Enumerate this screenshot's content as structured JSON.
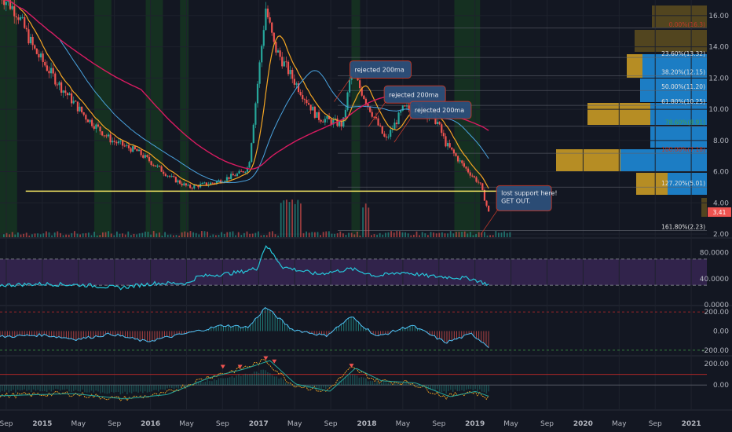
{
  "chart_data": {
    "type": "candlestick",
    "x_axis": {
      "ticks": [
        "Sep",
        "2015",
        "May",
        "Sep",
        "2016",
        "May",
        "Sep",
        "2017",
        "May",
        "Sep",
        "2018",
        "May",
        "Sep",
        "2019",
        "May",
        "Sep",
        "2020",
        "May",
        "Sep",
        "2021"
      ],
      "range": [
        "2014-08",
        "2021-06"
      ]
    },
    "y_axis": {
      "ticks": [
        "16.00",
        "14.00",
        "12.00",
        "10.00",
        "8.00",
        "6.00",
        "4.00",
        "2.00"
      ],
      "range": [
        1.8,
        16.9
      ]
    },
    "price_series": [
      {
        "date": "2014-08",
        "value": 17.4
      },
      {
        "date": "2014-10",
        "value": 16.2
      },
      {
        "date": "2014-12",
        "value": 13.8
      },
      {
        "date": "2015-03",
        "value": 11.5
      },
      {
        "date": "2015-06",
        "value": 9.5
      },
      {
        "date": "2015-09",
        "value": 8.0
      },
      {
        "date": "2015-12",
        "value": 7.3
      },
      {
        "date": "2016-04",
        "value": 5.6
      },
      {
        "date": "2016-06",
        "value": 5.0
      },
      {
        "date": "2016-09",
        "value": 5.3
      },
      {
        "date": "2016-12",
        "value": 5.9
      },
      {
        "date": "2017-01",
        "value": 6.3
      },
      {
        "date": "2017-03",
        "value": 16.5
      },
      {
        "date": "2017-04",
        "value": 14.0
      },
      {
        "date": "2017-06",
        "value": 12.1
      },
      {
        "date": "2017-09",
        "value": 9.5
      },
      {
        "date": "2017-12",
        "value": 9.0
      },
      {
        "date": "2018-01",
        "value": 12.5
      },
      {
        "date": "2018-03",
        "value": 10.2
      },
      {
        "date": "2018-05",
        "value": 8.0
      },
      {
        "date": "2018-07",
        "value": 10.0
      },
      {
        "date": "2018-09",
        "value": 10.1
      },
      {
        "date": "2018-11",
        "value": 9.2
      },
      {
        "date": "2018-12",
        "value": 7.8
      },
      {
        "date": "2019-02",
        "value": 6.4
      },
      {
        "date": "2019-04",
        "value": 5.2
      },
      {
        "date": "2019-05",
        "value": 3.4
      }
    ],
    "support_level": 4.75,
    "fibonacci_levels": [
      {
        "label": "0.00%(16.3)",
        "value": 15.2
      },
      {
        "label": "23.60%(13.32)",
        "value": 13.32
      },
      {
        "label": "38.20%(12.15)",
        "value": 12.15
      },
      {
        "label": "50.00%(11.20)",
        "value": 11.2
      },
      {
        "label": "61.80%(10.25)",
        "value": 10.25
      },
      {
        "label": "78.60%(8.91)",
        "value": 8.91
      },
      {
        "label": "100.00%(7.18)",
        "value": 7.18
      },
      {
        "label": "127.20%(5.01)",
        "value": 5.01
      },
      {
        "label": "161.80%(2.23)",
        "value": 2.23
      }
    ],
    "current_price_label": "3.41",
    "annotations": [
      {
        "text": "rejected 200ma",
        "date": "2018-01",
        "value": 13.0
      },
      {
        "text": "rejected 200ma",
        "date": "2018-05",
        "value": 11.4
      },
      {
        "text": "rejected 200ma",
        "date": "2018-08",
        "value": 10.4
      },
      {
        "text": "lost support here! GET OUT.",
        "date": "2019-05",
        "value": 5.0
      }
    ],
    "rsi_panel": {
      "ticks": [
        "80.0000",
        "40.0000",
        "0.0000"
      ],
      "range": [
        0,
        100
      ],
      "upper_band": 70,
      "lower_band": 30,
      "values": [
        {
          "date": "2014-08",
          "value": 30
        },
        {
          "date": "2015-01",
          "value": 32
        },
        {
          "date": "2015-06",
          "value": 30
        },
        {
          "date": "2015-10",
          "value": 26
        },
        {
          "date": "2016-02",
          "value": 33
        },
        {
          "date": "2016-06",
          "value": 33
        },
        {
          "date": "2016-07",
          "value": 43
        },
        {
          "date": "2016-10",
          "value": 47
        },
        {
          "date": "2016-12",
          "value": 50
        },
        {
          "date": "2017-02",
          "value": 56
        },
        {
          "date": "2017-03",
          "value": 92
        },
        {
          "date": "2017-05",
          "value": 58
        },
        {
          "date": "2017-09",
          "value": 47
        },
        {
          "date": "2018-01",
          "value": 55
        },
        {
          "date": "2018-04",
          "value": 44
        },
        {
          "date": "2018-07",
          "value": 50
        },
        {
          "date": "2018-10",
          "value": 44
        },
        {
          "date": "2019-01",
          "value": 42
        },
        {
          "date": "2019-03",
          "value": 40
        },
        {
          "date": "2019-05",
          "value": 31
        }
      ]
    },
    "cci_panel": {
      "ticks": [
        "200.00",
        "0.00",
        "-200.00"
      ],
      "range": [
        -250,
        250
      ],
      "values": [
        {
          "date": "2014-08",
          "value": -60
        },
        {
          "date": "2015-01",
          "value": -40
        },
        {
          "date": "2015-05",
          "value": -85
        },
        {
          "date": "2015-09",
          "value": -30
        },
        {
          "date": "2016-01",
          "value": -110
        },
        {
          "date": "2016-06",
          "value": -20
        },
        {
          "date": "2016-10",
          "value": 60
        },
        {
          "date": "2017-01",
          "value": 40
        },
        {
          "date": "2017-03",
          "value": 250
        },
        {
          "date": "2017-06",
          "value": 20
        },
        {
          "date": "2017-10",
          "value": -50
        },
        {
          "date": "2018-01",
          "value": 150
        },
        {
          "date": "2018-04",
          "value": -60
        },
        {
          "date": "2018-08",
          "value": 60
        },
        {
          "date": "2018-12",
          "value": -120
        },
        {
          "date": "2019-03",
          "value": -30
        },
        {
          "date": "2019-05",
          "value": -160
        }
      ]
    },
    "oscillator_panel": {
      "ticks": [
        "200.00",
        "0.00"
      ],
      "range": [
        -220,
        260
      ],
      "values": [
        {
          "date": "2014-08",
          "value": -100
        },
        {
          "date": "2015-04",
          "value": -80
        },
        {
          "date": "2015-10",
          "value": -130
        },
        {
          "date": "2016-03",
          "value": -90
        },
        {
          "date": "2016-08",
          "value": 70
        },
        {
          "date": "2016-12",
          "value": 150
        },
        {
          "date": "2017-03",
          "value": 230
        },
        {
          "date": "2017-06",
          "value": 10
        },
        {
          "date": "2017-10",
          "value": -60
        },
        {
          "date": "2018-01",
          "value": 160
        },
        {
          "date": "2018-04",
          "value": 40
        },
        {
          "date": "2018-08",
          "value": 20
        },
        {
          "date": "2018-12",
          "value": -110
        },
        {
          "date": "2019-03",
          "value": -60
        },
        {
          "date": "2019-05",
          "value": -120
        }
      ]
    }
  }
}
